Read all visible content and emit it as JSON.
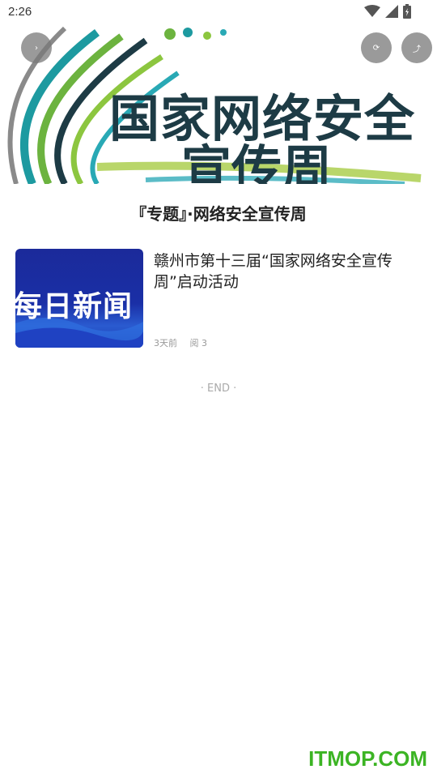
{
  "status_bar": {
    "time": "2:26"
  },
  "banner": {
    "line1": "国家网络安全",
    "line2": "宣传周"
  },
  "topic": {
    "title": "『专题』·网络安全宣传周"
  },
  "articles": [
    {
      "thumb_text": "每日新闻",
      "title": "赣州市第十三届“国家网络安全宣传周”启动活动",
      "time": "3天前",
      "reads": "阅 3"
    }
  ],
  "end_text": "· END ·",
  "watermark": "ITMOP.COM",
  "colors": {
    "banner_text": "#1d3b45",
    "thumb_bg": "#1a2fa6",
    "watermark": "#3cb424",
    "button_bg": "#787878"
  },
  "icons": [
    "wifi-icon",
    "signal-icon",
    "battery-icon",
    "chevron-right-icon",
    "share-icon",
    "refresh-icon"
  ]
}
